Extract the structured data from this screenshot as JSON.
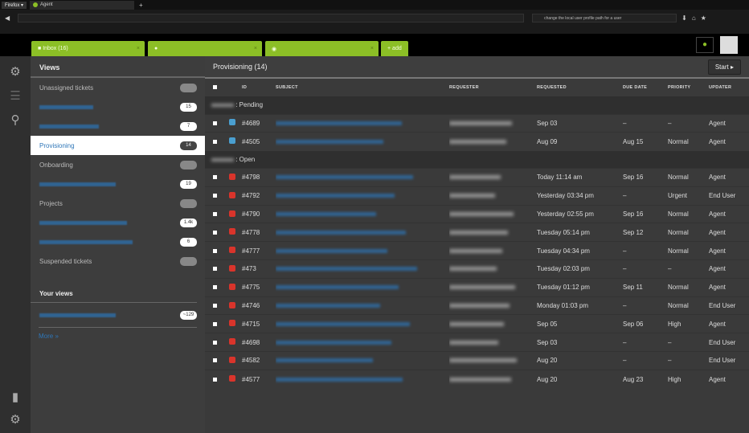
{
  "browser": {
    "menu": "Firefox ▾",
    "tab_title": "Agent",
    "url": "",
    "search": "change the local user profile path for a user"
  },
  "tabs": [
    {
      "label": "Inbox (16)"
    },
    {
      "label": ""
    },
    {
      "label": ""
    },
    {
      "label": "add"
    }
  ],
  "rail": {
    "icons": [
      "gear-icon",
      "list-icon",
      "search-icon",
      "chart-icon",
      "settings-icon"
    ]
  },
  "sidebar": {
    "title": "Views",
    "items": [
      {
        "label": "Unassigned tickets",
        "count": "0",
        "style": "grey"
      },
      {
        "label": "",
        "count": "15",
        "style": "link"
      },
      {
        "label": "",
        "count": "7",
        "style": "link"
      },
      {
        "label": "Provisioning",
        "count": "14",
        "style": "active"
      },
      {
        "label": "Onboarding",
        "count": "0",
        "style": "grey"
      },
      {
        "label": "",
        "count": "19",
        "style": "link"
      },
      {
        "label": "Projects",
        "count": "0",
        "style": "grey"
      },
      {
        "label": "",
        "count": "1.4k",
        "style": "link"
      },
      {
        "label": "",
        "count": "6",
        "style": "link"
      },
      {
        "label": "Suspended tickets",
        "count": "0",
        "style": "grey"
      }
    ],
    "your_views_title": "Your views",
    "your_views": [
      {
        "label": "",
        "count": "~129"
      }
    ],
    "more": "More »"
  },
  "main": {
    "title": "Provisioning (14)",
    "start": "Start",
    "columns": [
      "ID",
      "SUBJECT",
      "REQUESTER",
      "REQUESTED",
      "DUE DATE",
      "PRIORITY",
      "UPDATER"
    ],
    "groups": [
      {
        "label": "Pending",
        "status_color": "#4a9fd0",
        "rows": [
          [
            "#4689",
            "Sep 03",
            "–",
            "–",
            "Agent"
          ],
          [
            "#4505",
            "Aug 09",
            "Aug 15",
            "Normal",
            "Agent"
          ]
        ]
      },
      {
        "label": "Open",
        "status_color": "#d9342b",
        "rows": [
          [
            "#4798",
            "Today 11:14 am",
            "Sep 16",
            "Normal",
            "Agent"
          ],
          [
            "#4792",
            "Yesterday 03:34 pm",
            "–",
            "Urgent",
            "End User"
          ],
          [
            "#4790",
            "Yesterday 02:55 pm",
            "Sep 16",
            "Normal",
            "Agent"
          ],
          [
            "#4778",
            "Tuesday 05:14 pm",
            "Sep 12",
            "Normal",
            "Agent"
          ],
          [
            "#4777",
            "Tuesday 04:34 pm",
            "–",
            "Normal",
            "Agent"
          ],
          [
            "#473",
            "Tuesday 02:03 pm",
            "–",
            "–",
            "Agent"
          ],
          [
            "#4775",
            "Tuesday 01:12 pm",
            "Sep 11",
            "Normal",
            "Agent"
          ],
          [
            "#4746",
            "Monday 01:03 pm",
            "–",
            "Normal",
            "End User"
          ],
          [
            "#4715",
            "Sep 05",
            "Sep 06",
            "High",
            "Agent"
          ],
          [
            "#4698",
            "Sep 03",
            "–",
            "–",
            "End User"
          ],
          [
            "#4582",
            "Aug 20",
            "–",
            "–",
            "End User"
          ],
          [
            "#4577",
            "Aug 20",
            "Aug 23",
            "High",
            "Agent"
          ]
        ]
      }
    ]
  },
  "colors": {
    "accent": "#8cbf26",
    "link": "#2e76b8",
    "pending": "#4a9fd0",
    "open": "#d9342b"
  }
}
